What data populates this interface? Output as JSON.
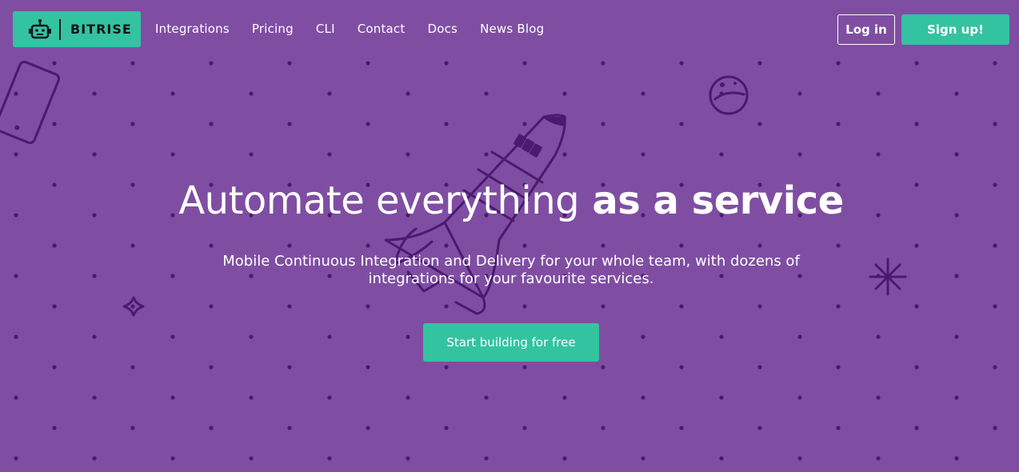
{
  "header": {
    "logo_text": "BITRISE",
    "nav": [
      {
        "label": "Integrations"
      },
      {
        "label": "Pricing"
      },
      {
        "label": "CLI"
      },
      {
        "label": "Contact"
      },
      {
        "label": "Docs"
      },
      {
        "label": "News Blog"
      }
    ],
    "login_label": "Log in",
    "signup_label": "Sign up!"
  },
  "hero": {
    "title_regular": "Automate everything",
    "title_bold": "as a service",
    "subtitle": "Mobile Continuous Integration and Delivery for your whole team, with dozens of integrations for your favourite services.",
    "cta_label": "Start building for free"
  },
  "colors": {
    "background": "#7f4ea3",
    "accent": "#33c3a0",
    "illustration": "#4a1a70"
  },
  "icons": [
    "robot-logo-icon",
    "phone-icon",
    "planet-icon",
    "rocket-icon",
    "sparkle-icon",
    "star-icon"
  ]
}
